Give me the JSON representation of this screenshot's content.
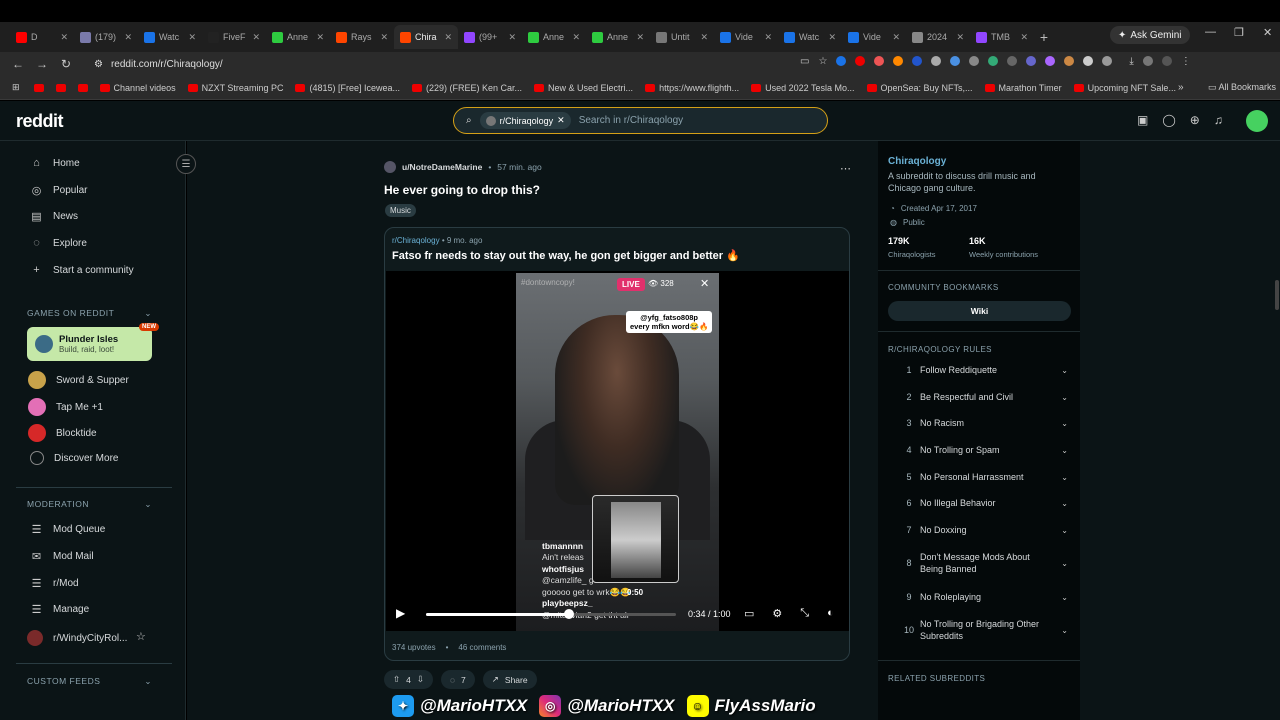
{
  "browser": {
    "tabs": [
      {
        "label": "D",
        "color": "#ff0000"
      },
      {
        "label": "(179)",
        "color": "#7a7aaa"
      },
      {
        "label": "Watc",
        "color": "#1a73e8"
      },
      {
        "label": "FiveF",
        "color": "#222222"
      },
      {
        "label": "Anne",
        "color": "#2ecc40"
      },
      {
        "label": "Rays",
        "color": "#ff4500"
      },
      {
        "label": "Chira",
        "color": "#ff4500"
      },
      {
        "label": "(99+",
        "color": "#9146ff"
      },
      {
        "label": "Anne",
        "color": "#2ecc40"
      },
      {
        "label": "Anne",
        "color": "#2ecc40"
      },
      {
        "label": "Untit",
        "color": "#777777"
      },
      {
        "label": "Vide",
        "color": "#1a73e8"
      },
      {
        "label": "Watc",
        "color": "#1a73e8"
      },
      {
        "label": "Vide",
        "color": "#1a73e8"
      },
      {
        "label": "2024",
        "color": "#888888"
      },
      {
        "label": "TMB",
        "color": "#9146ff"
      }
    ],
    "active_tab_index": 6,
    "ask_gemini": "Ask Gemini",
    "url": "reddit.com/r/Chiraqology/",
    "bookmarks": [
      "Channel videos",
      "NZXT Streaming PC",
      "(4815) [Free] Icewea...",
      "(229) (FREE) Ken Car...",
      "New & Used Electri...",
      "https://www.flighth...",
      "Used 2022 Tesla Mo...",
      "OpenSea: Buy NFTs,...",
      "Marathon Timer",
      "Upcoming NFT Sale..."
    ],
    "all_bookmarks": "All Bookmarks"
  },
  "header": {
    "logo": "reddit",
    "search_chip": "r/Chiraqology",
    "search_placeholder": "Search in r/Chiraqology"
  },
  "sidebar": {
    "nav": [
      {
        "label": "Home",
        "icon": "home-icon",
        "glyph": "⌂"
      },
      {
        "label": "Popular",
        "icon": "popular-icon",
        "glyph": "◎"
      },
      {
        "label": "News",
        "icon": "news-icon",
        "glyph": "▤"
      },
      {
        "label": "Explore",
        "icon": "explore-icon",
        "glyph": "◌"
      },
      {
        "label": "Start a community",
        "icon": "plus-icon",
        "glyph": "+"
      }
    ],
    "games_title": "GAMES ON REDDIT",
    "featured_game": {
      "title": "Plunder Isles",
      "subtitle": "Build, raid, loot!",
      "badge": "NEW"
    },
    "games": [
      {
        "label": "Sword & Supper",
        "color": "#c8a24a"
      },
      {
        "label": "Tap Me +1",
        "color": "#e36fb6"
      },
      {
        "label": "Blocktide",
        "color": "#d62828"
      },
      {
        "label": "Discover More",
        "color": ""
      }
    ],
    "moderation_title": "MODERATION",
    "moderation": [
      {
        "label": "Mod Queue",
        "icon": "mod-queue-icon",
        "glyph": "☰"
      },
      {
        "label": "Mod Mail",
        "icon": "mod-mail-icon",
        "glyph": "✉"
      },
      {
        "label": "r/Mod",
        "icon": "mod-icon",
        "glyph": "☰"
      },
      {
        "label": "Manage",
        "icon": "manage-icon",
        "glyph": "☰"
      },
      {
        "label": "r/WindyCityRol...",
        "icon": "windycity-avatar",
        "glyph": ""
      }
    ],
    "custom_feeds_title": "CUSTOM FEEDS"
  },
  "post": {
    "author": "u/NotreDameMarine",
    "time": "57 min. ago",
    "title": "He ever going to drop this?",
    "flair": "Music",
    "crosspost": {
      "subreddit": "r/Chiraqology",
      "time": "9 mo. ago",
      "title": "Fatso fr needs to stay out the way, he gon get bigger and better 🔥",
      "upvotes": "374 upvotes",
      "comments": "46 comments"
    },
    "video": {
      "ig_tag": "#dontowncopy!",
      "live": "LIVE",
      "viewers": "328",
      "caption_line1": "@yfg_fatso808p",
      "caption_line2": "every mfkn word😂🔥",
      "pip_time": "0:50",
      "comments": [
        {
          "user": "tbmannnn",
          "text": "Ain't releas"
        },
        {
          "user": "whotfisjus",
          "text": "@camzlife_ get o     at wrk"
        },
        {
          "user": "",
          "text": "gooooo get to wrk😂😂"
        },
        {
          "user": "playbeepsz_",
          "text": "@mitaovian2 get tht alr"
        }
      ],
      "current_time": "0:34",
      "duration": "1:00",
      "progress": 0.57
    },
    "score": "4",
    "comment_count": "7",
    "share": "Share"
  },
  "community": {
    "name": "Chiraqology",
    "description": "A subreddit to discuss drill music and Chicago gang culture.",
    "created": "Created Apr 17, 2017",
    "visibility": "Public",
    "members": "179K",
    "members_label": "Chiraqologists",
    "weekly": "16K",
    "weekly_label": "Weekly contributions",
    "bookmarks_title": "COMMUNITY BOOKMARKS",
    "wiki": "Wiki",
    "rules_title": "R/CHIRAQOLOGY RULES",
    "rules": [
      {
        "n": "1",
        "text": "Follow Reddiquette"
      },
      {
        "n": "2",
        "text": "Be Respectful and Civil"
      },
      {
        "n": "3",
        "text": "No Racism"
      },
      {
        "n": "4",
        "text": "No Trolling or Spam"
      },
      {
        "n": "5",
        "text": "No Personal Harrassment"
      },
      {
        "n": "6",
        "text": "No Illegal Behavior"
      },
      {
        "n": "7",
        "text": "No Doxxing"
      },
      {
        "n": "8",
        "text": "Don't Message Mods About Being Banned"
      },
      {
        "n": "9",
        "text": "No Roleplaying"
      },
      {
        "n": "10",
        "text": "No Trolling or Brigading Other Subreddits"
      }
    ],
    "related_title": "RELATED SUBREDDITS"
  },
  "watermark": {
    "twitter": "@MarioHTXX",
    "instagram": "@MarioHTXX",
    "snapchat": "FlyAssMario"
  },
  "colors": {
    "accent_search": "#d4a017",
    "reddit_bg": "#0b1416",
    "link": "#6bb2d6",
    "live": "#e1306c"
  }
}
